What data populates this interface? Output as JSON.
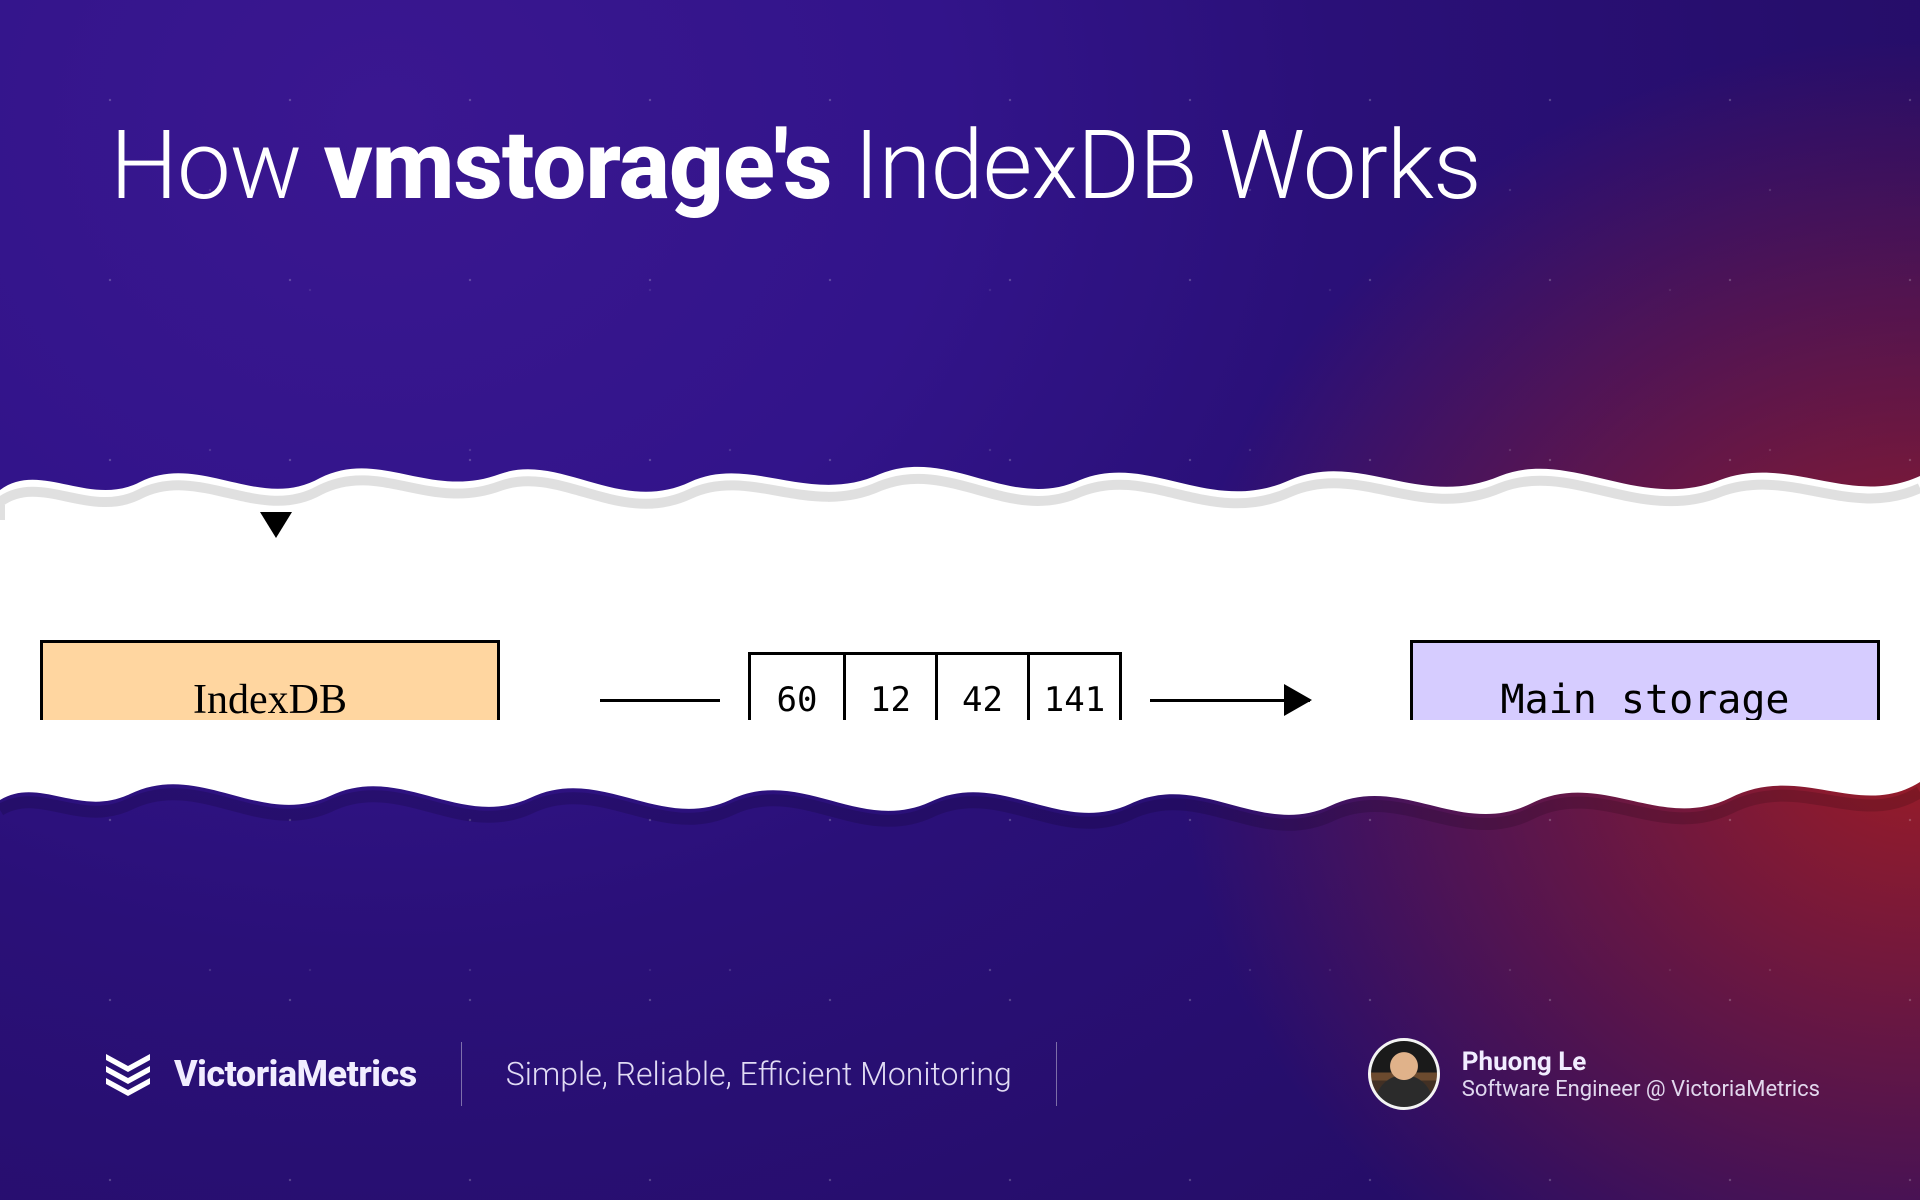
{
  "title": {
    "pre": "How ",
    "strong": "vmstorage's",
    "post": " IndexDB Works"
  },
  "diagram": {
    "left_box": "IndexDB",
    "right_box": "Main storage",
    "cells": [
      "60",
      "12",
      "42",
      "141"
    ]
  },
  "footer": {
    "brand": "VictoriaMetrics",
    "tagline": "Simple, Reliable, Efficient Monitoring",
    "author_name": "Phuong Le",
    "author_role": "Software Engineer @ VictoriaMetrics"
  }
}
